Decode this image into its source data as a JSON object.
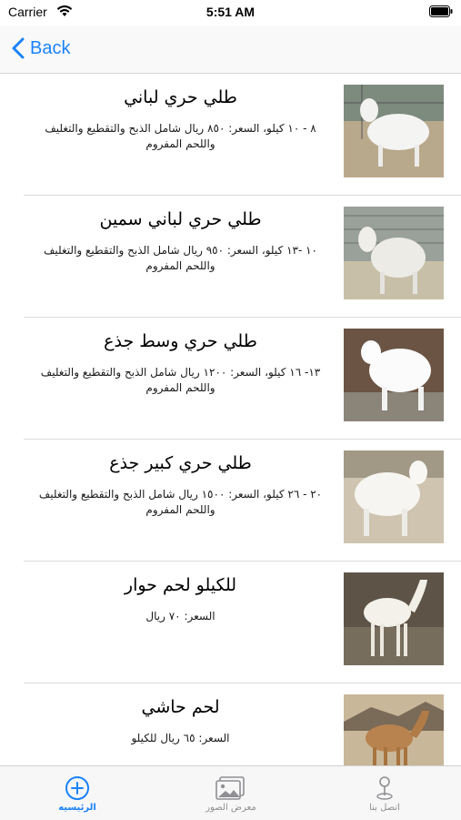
{
  "status_bar": {
    "carrier": "Carrier",
    "time": "5:51 AM"
  },
  "nav": {
    "back_label": "Back"
  },
  "items": [
    {
      "title": "طلي حري لباني",
      "description": "٨ - ١٠ كيلو، السعر: ٨٥٠ ريال شامل الذبح والتقطيع والتغليف واللحم المفروم",
      "image": "sheep-photo"
    },
    {
      "title": "طلي حري لباني سمين",
      "description": "١٠ -١٣ كيلو، السعر: ٩٥٠ ريال شامل الذبح والتقطيع والتغليف واللحم المفروم",
      "image": "sheep-photo"
    },
    {
      "title": "طلي حري وسط جذع",
      "description": "١٣- ١٦ كيلو، السعر: ١٢٠٠ ريال شامل الذبح والتقطيع والتغليف واللحم المفروم",
      "image": "sheep-photo"
    },
    {
      "title": "طلي حري كبير جذع",
      "description": "٢٠ - ٢٦ كيلو، السعر: ١٥٠٠ ريال شامل الذبح والتقطيع والتغليف واللحم المفروم",
      "image": "sheep-photo"
    },
    {
      "title": "للكيلو لحم حوار",
      "description": "السعر: ٧٠ ريال",
      "image": "camel-photo"
    },
    {
      "title": "لحم حاشي",
      "description": "السعر: ٦٥ ريال للكيلو",
      "image": "camel-photo"
    }
  ],
  "tabs": [
    {
      "label": "الرئيسيه",
      "icon": "plus-circle-icon",
      "active": true
    },
    {
      "label": "معرض الصور",
      "icon": "gallery-icon",
      "active": false
    },
    {
      "label": "اتصل بنا",
      "icon": "location-pin-icon",
      "active": false
    }
  ],
  "colors": {
    "accent": "#1a82fb",
    "inactive": "#8e8e93"
  }
}
